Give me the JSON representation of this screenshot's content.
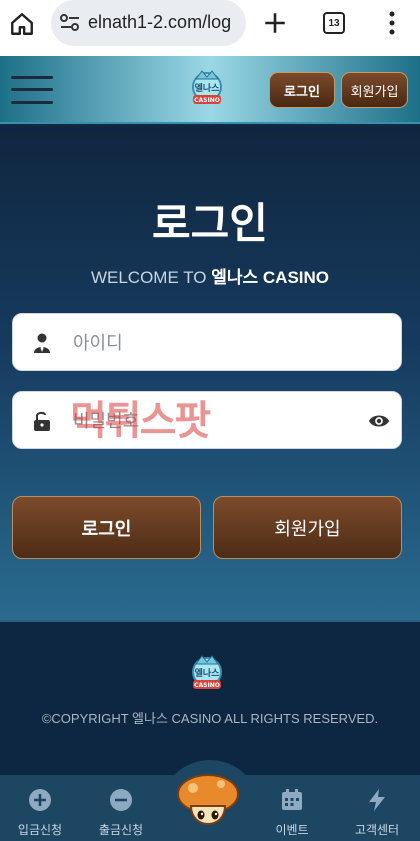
{
  "browser": {
    "url": "elnath1-2.com/log",
    "tab_count": "13"
  },
  "header": {
    "login_label": "로그인",
    "join_label": "회원가입",
    "logo_alt": "엘나스 CASINO"
  },
  "main": {
    "title": "로그인",
    "welcome_prefix": "WELCOME TO ",
    "welcome_brand": "엘나스 CASINO",
    "id_placeholder": "아이디",
    "pw_placeholder": "비밀번호",
    "watermark": "먹튀스팟",
    "login_button": "로그인",
    "join_button": "회원가입"
  },
  "footer": {
    "copyright": "©COPYRIGHT 엘나스 CASINO ALL RIGHTS RESERVED."
  },
  "bottom_nav": {
    "items": [
      {
        "label": "입금신청",
        "icon": "plus-circle-icon"
      },
      {
        "label": "출금신청",
        "icon": "minus-circle-icon"
      },
      {
        "label": "이벤트",
        "icon": "calendar-icon"
      },
      {
        "label": "고객센터",
        "icon": "lightning-icon"
      }
    ]
  },
  "colors": {
    "brown_button": "#6b3f22",
    "header_teal": "#9ad8e6",
    "page_bg": "#163b5f",
    "nav_bg": "#1d4663"
  }
}
